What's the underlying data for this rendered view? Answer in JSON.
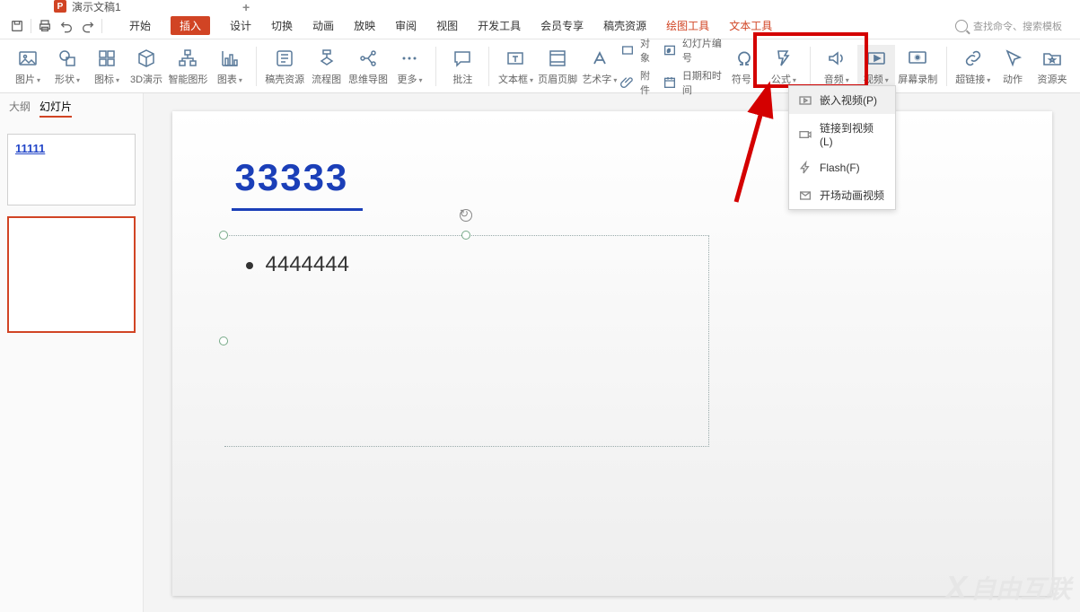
{
  "filetab": {
    "title": "演示文稿1"
  },
  "menubar": {
    "items": [
      "开始",
      "插入",
      "设计",
      "切换",
      "动画",
      "放映",
      "审阅",
      "视图",
      "开发工具",
      "会员专享",
      "稿壳资源"
    ],
    "context": [
      "绘图工具",
      "文本工具"
    ],
    "search_placeholder": "查找命令、搜索模板"
  },
  "ribbon": {
    "items": {
      "picture": "图片",
      "shapes": "形状",
      "icon": "图标",
      "3d": "3D演示",
      "smartart": "智能图形",
      "chart": "图表",
      "docke": "稿壳资源",
      "flowchart": "流程图",
      "mindmap": "思维导图",
      "more": "更多",
      "comment": "批注",
      "textbox": "文本框",
      "headerfooter": "页眉页脚",
      "wordart": "艺术字",
      "object": "对象",
      "slidenum": "幻灯片编号",
      "attachment": "附件",
      "datetime": "日期和时间",
      "symbol": "符号",
      "formula": "公式",
      "audio": "音频",
      "video": "视频",
      "screenrec": "屏幕录制",
      "hyperlink": "超链接",
      "action": "动作",
      "resourcefolder": "资源夹"
    }
  },
  "dropdown": {
    "items": [
      "嵌入视频(P)",
      "链接到视频(L)",
      "Flash(F)",
      "开场动画视频"
    ]
  },
  "side": {
    "tabs": {
      "outline": "大纲",
      "slides": "幻灯片"
    },
    "thumb1_title": "11111"
  },
  "slide": {
    "title": "33333",
    "bullet": "4444444"
  },
  "watermark": "自由互联"
}
